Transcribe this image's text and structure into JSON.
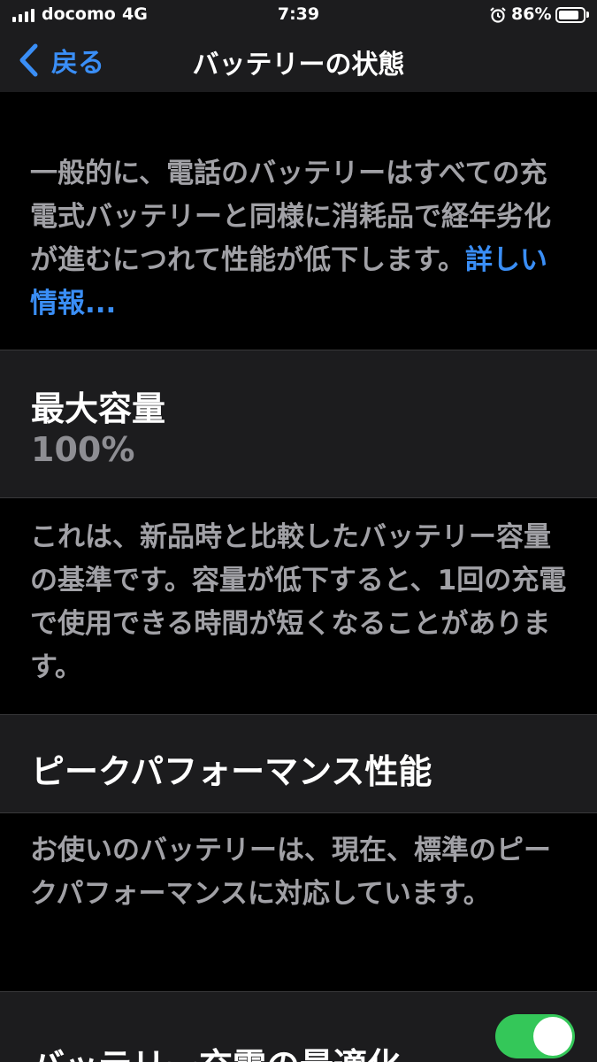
{
  "status_bar": {
    "carrier": "docomo",
    "network": "4G",
    "time": "7:39",
    "battery_percent": "86%",
    "battery_level": 0.86
  },
  "nav": {
    "back_label": "戻る",
    "title": "バッテリーの状態"
  },
  "intro": {
    "text": "一般的に、電話のバッテリーはすべての充電式バッテリーと同様に消耗品で経年劣化が進むにつれて性能が低下します。",
    "link_label": "詳しい情報..."
  },
  "max_capacity": {
    "title": "最大容量",
    "value": "100%",
    "description": "これは、新品時と比較したバッテリー容量の基準です。容量が低下すると、1回の充電で使用できる時間が短くなることがあります。"
  },
  "peak_performance": {
    "title": "ピークパフォーマンス性能",
    "description": "お使いのバッテリーは、現在、標準のピークパフォーマンスに対応しています。"
  },
  "optimized_charging": {
    "title": "バッテリー充電の最適化",
    "enabled": true
  },
  "colors": {
    "accent": "#3a8ef6",
    "toggle_on": "#34c759",
    "cell_bg": "#1c1c1e",
    "secondary_text": "#a1a1a6"
  }
}
